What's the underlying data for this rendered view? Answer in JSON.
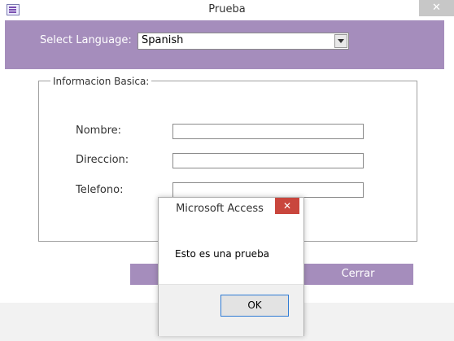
{
  "window": {
    "title": "Prueba",
    "close_glyph": "✕",
    "icon": "form-icon"
  },
  "language": {
    "label": "Select Language:",
    "selected": "Spanish"
  },
  "group": {
    "title": "Informacion Basica:",
    "fields": [
      {
        "label": "Nombre:",
        "value": ""
      },
      {
        "label": "Direccion:",
        "value": ""
      },
      {
        "label": "Telefono:",
        "value": ""
      }
    ]
  },
  "actions": {
    "left_label": "",
    "close_label": "Cerrar"
  },
  "dialog": {
    "title": "Microsoft Access",
    "close_glyph": "✕",
    "message": "Esto es una prueba",
    "ok_label": "OK"
  },
  "colors": {
    "accent": "#a58dbc",
    "dialog_close": "#c9463d",
    "ok_border": "#2f7bd4"
  }
}
